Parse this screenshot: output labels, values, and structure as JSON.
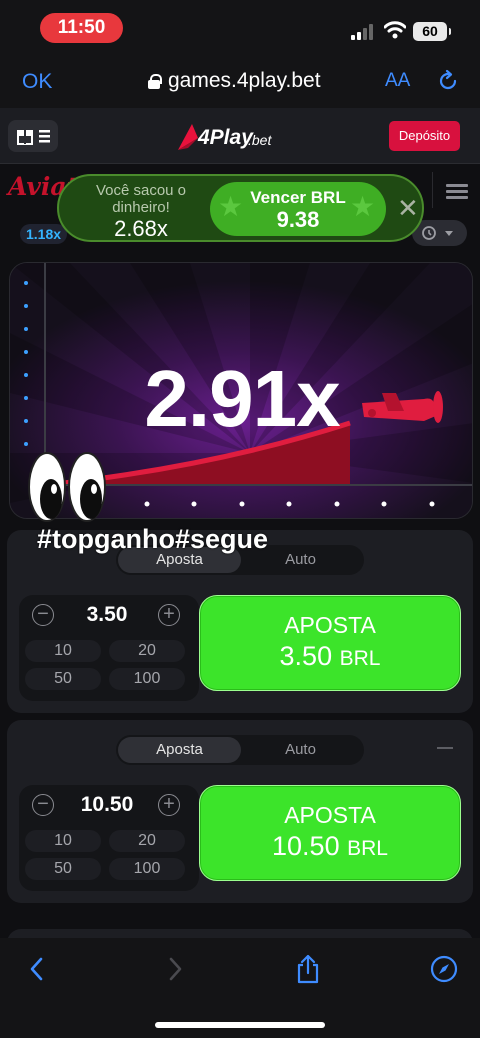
{
  "status_bar": {
    "time": "11:50",
    "battery": "60"
  },
  "browser": {
    "done_label": "OK",
    "url": "games.4play.bet",
    "text_size_label": "AA"
  },
  "site": {
    "logo_text": "4Play",
    "logo_suffix": ".bet",
    "deposit_label": "Depósito"
  },
  "game": {
    "brand": "Aviat",
    "history_multiplier": "1.18x",
    "current_multiplier": "2.91x",
    "overlay_hashtag": "#topganho#segue"
  },
  "toast": {
    "label": "Você sacou o dinheiro!",
    "cashout_multiplier": "2.68x",
    "win_title": "Vencer BRL",
    "win_amount": "9.38"
  },
  "bets": [
    {
      "tab_bet": "Aposta",
      "tab_auto": "Auto",
      "stake": "3.50",
      "quick": [
        "10",
        "20",
        "50",
        "100"
      ],
      "button_label": "APOSTA",
      "button_amount": "3.50",
      "currency": "BRL"
    },
    {
      "tab_bet": "Aposta",
      "tab_auto": "Auto",
      "stake": "10.50",
      "quick": [
        "10",
        "20",
        "50",
        "100"
      ],
      "button_label": "APOSTA",
      "button_amount": "10.50",
      "currency": "BRL"
    }
  ],
  "colors": {
    "bet_green": "#3ce42a",
    "deposit_red": "#d8113e",
    "link_blue": "#3f8cff",
    "plane_red": "#e01d3f"
  }
}
